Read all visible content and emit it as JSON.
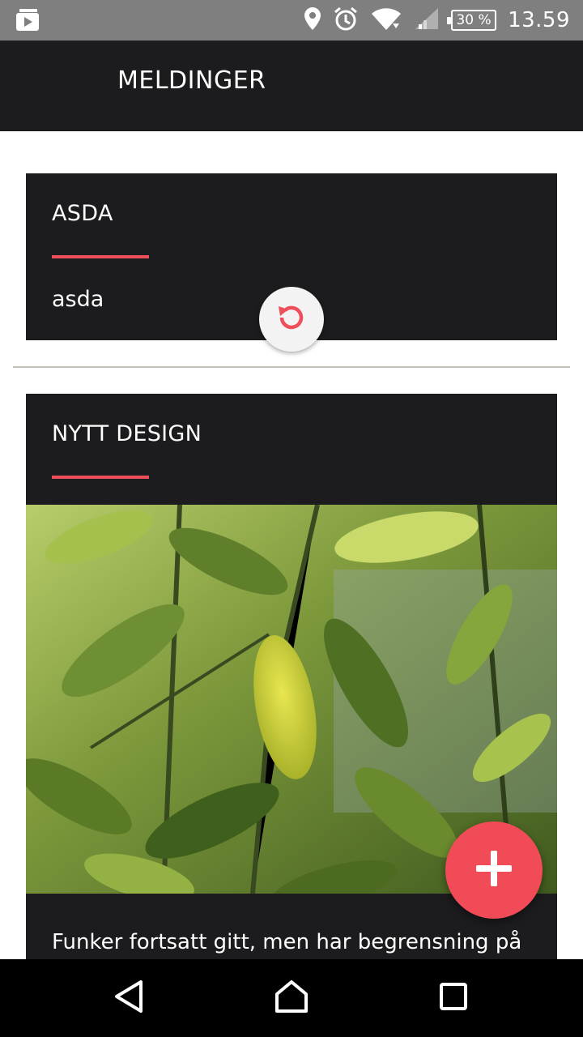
{
  "status_bar": {
    "time": "13.59",
    "battery": "30 %",
    "icons": [
      "media-icon",
      "location-icon",
      "alarm-icon",
      "wifi-icon",
      "signal-icon",
      "battery-icon"
    ]
  },
  "app_bar": {
    "title": "MELDINGER"
  },
  "messages": [
    {
      "title": "ASDA",
      "body": "asda"
    },
    {
      "title": "NYTT DESIGN",
      "image": "green-leaves-photo",
      "body": "Funker fortsatt gitt, men har begrensning på"
    }
  ],
  "fab": {
    "icon": "plus-icon"
  },
  "refresh": {
    "icon": "refresh-icon"
  },
  "nav_bar": {
    "buttons": [
      "back-icon",
      "home-icon",
      "recents-icon"
    ]
  },
  "colors": {
    "accent": "#ef4f5a",
    "card": "#1c1b1d",
    "appbar": "#1c1b1d",
    "status_bar": "#7f7f7f"
  }
}
